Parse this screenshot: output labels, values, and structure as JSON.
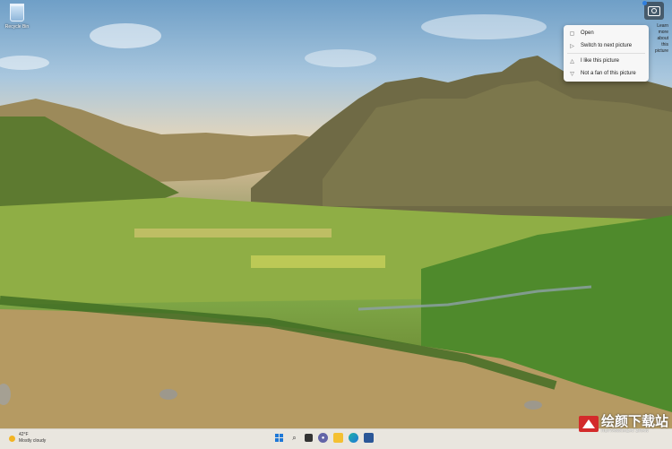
{
  "desktop": {
    "recycle_bin_label": "Recycle Bin",
    "icon": "recycle-bin-icon"
  },
  "spotlight": {
    "button_icon": "camera-icon",
    "side_text": [
      "Learn more",
      "about this",
      "picture"
    ]
  },
  "context_menu": {
    "items": [
      {
        "label": "Open",
        "icon": "open-icon"
      },
      {
        "label": "Switch to next picture",
        "icon": "next-icon"
      },
      {
        "label": "I like this picture",
        "icon": "thumbs-up-icon"
      },
      {
        "label": "Not a fan of this picture",
        "icon": "thumbs-down-icon"
      }
    ]
  },
  "taskbar": {
    "weather_temp": "42°F",
    "weather_desc": "Mostly cloudy",
    "icons": [
      "windows-start-icon",
      "search-icon",
      "task-view-icon",
      "chat-icon",
      "file-explorer-icon",
      "edge-icon",
      "store-icon"
    ]
  },
  "watermark": {
    "text": "绘颜下载站",
    "sub": "HUIYANXIAZAI ZHAN"
  },
  "colors": {
    "accent": "#1e78d7",
    "menu_bg": "#f7f7f7",
    "taskbar_bg": "#e9e6df"
  }
}
